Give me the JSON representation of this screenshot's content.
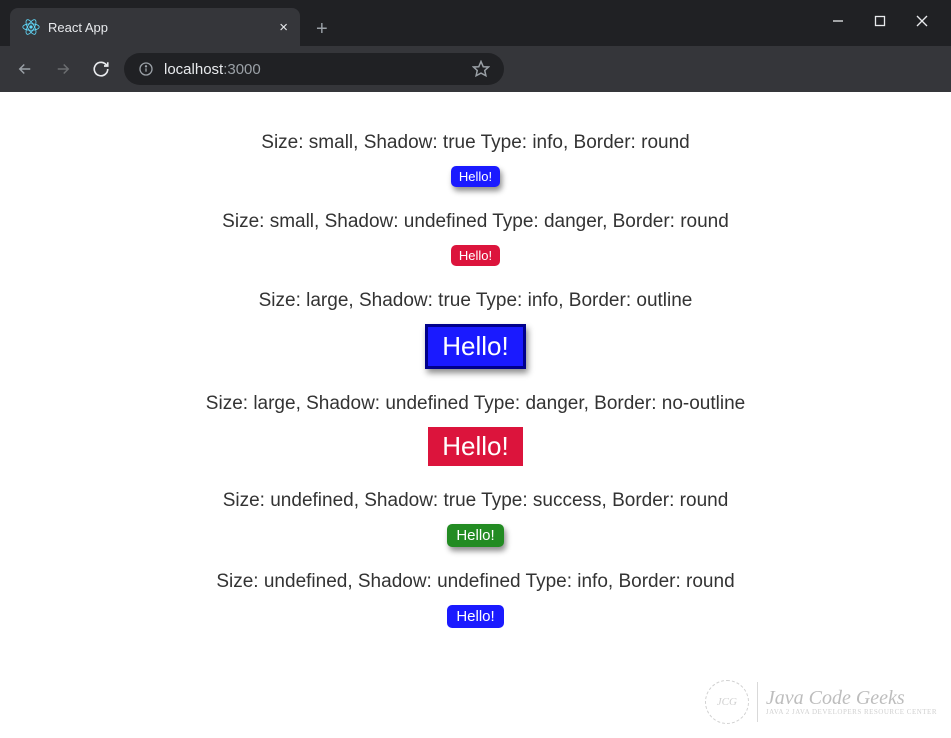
{
  "browser": {
    "tab_title": "React App",
    "url_host": "localhost",
    "url_port": ":3000"
  },
  "rows": [
    {
      "desc": "Size: small, Shadow: true Type: info, Border: round",
      "label": "Hello!",
      "size": "small",
      "shadow": true,
      "type": "info",
      "border": "round"
    },
    {
      "desc": "Size: small, Shadow: undefined Type: danger, Border: round",
      "label": "Hello!",
      "size": "small",
      "shadow": false,
      "type": "danger",
      "border": "round"
    },
    {
      "desc": "Size: large, Shadow: true Type: info, Border: outline",
      "label": "Hello!",
      "size": "large",
      "shadow": true,
      "type": "info",
      "border": "outline"
    },
    {
      "desc": "Size: large, Shadow: undefined Type: danger, Border: no-outline",
      "label": "Hello!",
      "size": "large",
      "shadow": false,
      "type": "danger",
      "border": "no-outline"
    },
    {
      "desc": "Size: undefined, Shadow: true Type: success, Border: round",
      "label": "Hello!",
      "size": "med",
      "shadow": true,
      "type": "success",
      "border": "round"
    },
    {
      "desc": "Size: undefined, Shadow: undefined Type: info, Border: round",
      "label": "Hello!",
      "size": "med",
      "shadow": false,
      "type": "info",
      "border": "round"
    }
  ],
  "watermark": {
    "badge": "JCG",
    "title": "Java Code Geeks",
    "subtitle": "JAVA 2 JAVA DEVELOPERS RESOURCE CENTER"
  }
}
